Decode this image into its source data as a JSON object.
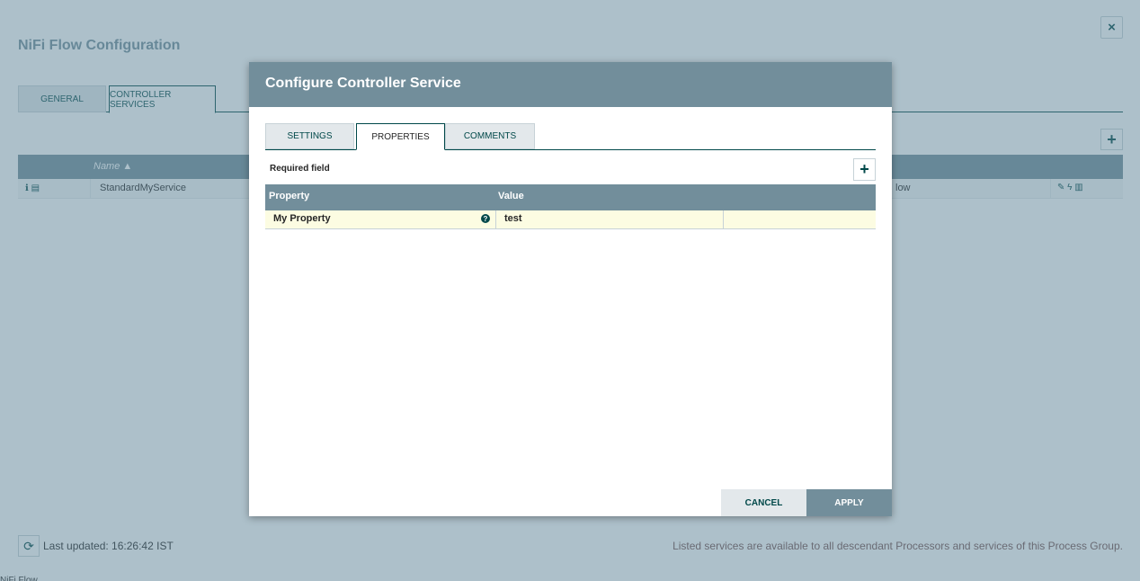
{
  "background": {
    "title": "NiFi Flow Configuration",
    "close_icon": "×",
    "tabs": [
      {
        "label": "GENERAL"
      },
      {
        "label": "CONTROLLER SERVICES"
      }
    ],
    "add_icon": "+",
    "grid": {
      "name_header": "Name ▲",
      "row": {
        "icons": "ℹ ▤",
        "name": "StandardMyService",
        "scope": "low",
        "actions": "✎ ϟ ▥"
      }
    },
    "refresh_icon": "⟳",
    "last_updated": "Last updated: 16:26:42 IST",
    "footer_note": "Listed services are available to all descendant Processors and services of this Process Group.",
    "bottom_strip": "NiFi Flow"
  },
  "dialog": {
    "title": "Configure Controller Service",
    "tabs": [
      {
        "label": "SETTINGS"
      },
      {
        "label": "PROPERTIES"
      },
      {
        "label": "COMMENTS"
      }
    ],
    "required_label": "Required field",
    "add_property_icon": "+",
    "table": {
      "headers": {
        "property": "Property",
        "value": "Value"
      },
      "rows": [
        {
          "property": "My Property",
          "help_icon": "?",
          "value": "test"
        }
      ]
    },
    "buttons": {
      "cancel": "CANCEL",
      "apply": "APPLY"
    }
  },
  "colors": {
    "header": "#728e9b",
    "accent": "#004849",
    "row_highlight": "#fcfce2",
    "overlay": "rgba(92,130,150,0.5)"
  }
}
